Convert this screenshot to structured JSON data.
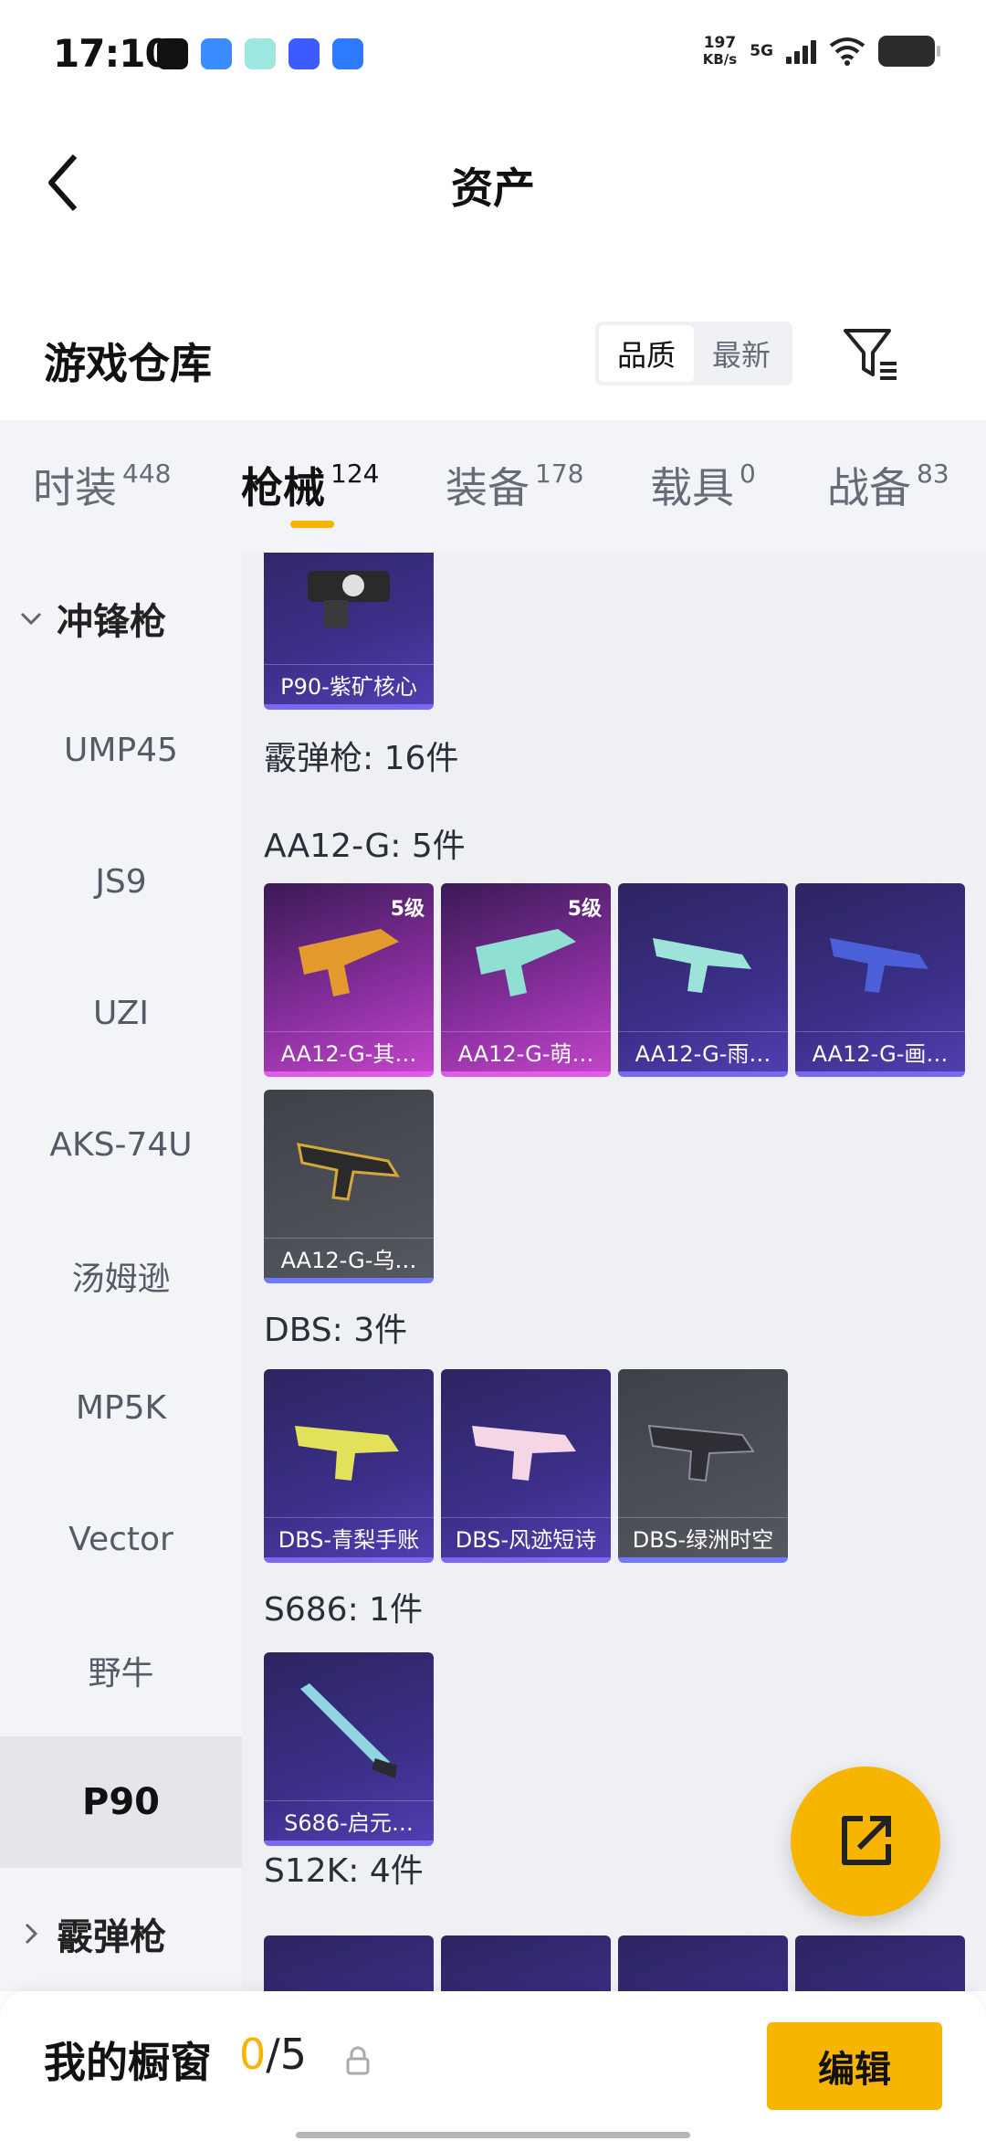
{
  "status_bar": {
    "time": "17:10",
    "net_speed": "197",
    "net_unit": "KB/s",
    "network": "5G"
  },
  "header": {
    "title": "资产"
  },
  "warehouse": {
    "title": "游戏仓库",
    "sort_options": [
      "品质",
      "最新"
    ],
    "selected_sort": "品质"
  },
  "tabs": [
    {
      "label": "时装",
      "count": "448"
    },
    {
      "label": "枪械",
      "count": "124"
    },
    {
      "label": "装备",
      "count": "178"
    },
    {
      "label": "载具",
      "count": "0"
    },
    {
      "label": "战备",
      "count": "83"
    }
  ],
  "active_tab": "枪械",
  "sidebar": {
    "group_expanded": "冲锋枪",
    "items": [
      "UMP45",
      "JS9",
      "UZI",
      "AKS-74U",
      "汤姆逊",
      "MP5K",
      "Vector",
      "野牛",
      "P90"
    ],
    "active_item": "P90",
    "group_collapsed": "霰弹枪"
  },
  "content": {
    "top_card": "P90-紫矿核心",
    "category_label": "霰弹枪: 16件",
    "groups": [
      {
        "label": "AA12-G: 5件",
        "cards": [
          {
            "name": "AA12-G-其…",
            "level": "5级",
            "rarity": "pink"
          },
          {
            "name": "AA12-G-萌…",
            "level": "5级",
            "rarity": "pink"
          },
          {
            "name": "AA12-G-雨…",
            "level": "",
            "rarity": "purple"
          },
          {
            "name": "AA12-G-画…",
            "level": "",
            "rarity": "purple"
          },
          {
            "name": "AA12-G-乌…",
            "level": "",
            "rarity": "gray"
          }
        ]
      },
      {
        "label": "DBS: 3件",
        "cards": [
          {
            "name": "DBS-青梨手账",
            "level": "",
            "rarity": "purple"
          },
          {
            "name": "DBS-风迹短诗",
            "level": "",
            "rarity": "purple"
          },
          {
            "name": "DBS-绿洲时空",
            "level": "",
            "rarity": "gray"
          }
        ]
      },
      {
        "label": "S686: 1件",
        "cards": [
          {
            "name": "S686-启元…",
            "level": "",
            "rarity": "purple"
          }
        ]
      },
      {
        "label": "S12K: 4件",
        "cards": []
      }
    ]
  },
  "bottom_bar": {
    "label": "我的橱窗",
    "current": "0",
    "total": "/5",
    "edit_label": "编辑"
  },
  "colors": {
    "accent": "#f7b500",
    "purple_rarity": "#7b68f0",
    "pink_rarity": "#e25be8"
  },
  "icons": [
    "back-arrow-icon",
    "filter-icon",
    "share-icon",
    "lock-icon",
    "chevron-down-icon",
    "chevron-right-icon"
  ]
}
